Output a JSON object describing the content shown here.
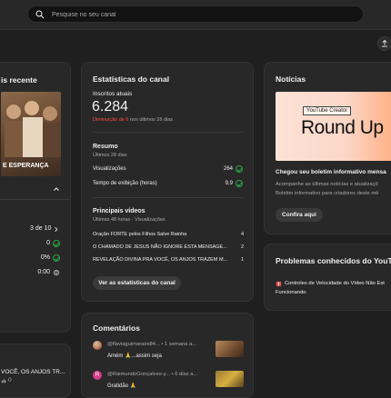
{
  "search": {
    "placeholder": "Pesquise no seu canal"
  },
  "latest_video": {
    "title_partial": "is recente",
    "thumbnail_text": "E ESPERANÇA",
    "rows": [
      {
        "value": "3 de 10"
      },
      {
        "value": "0"
      },
      {
        "value": "0%"
      },
      {
        "value": "0:00"
      }
    ],
    "bottom_title": "VOCÊ, OS ANJOS TR...",
    "bottom_value": "0"
  },
  "analytics": {
    "title": "Estatísticas do canal",
    "subs_label": "Inscritos atuais",
    "subs_value": "6.284",
    "subs_change_num": "Diminuição de 6",
    "subs_change_rest": " nos últimos 28 dias",
    "summary_title": "Resumo",
    "summary_period": "Últimos 28 dias",
    "summary_rows": [
      {
        "label": "Visualizações",
        "value": "264"
      },
      {
        "label": "Tempo de exibição (horas)",
        "value": "9,9"
      }
    ],
    "top_title": "Principais vídeos",
    "top_sub": "Últimas 48 horas · Visualizações",
    "top_videos": [
      {
        "title": "Oração FORTE pelos Filhos Salve Rainha",
        "views": "4"
      },
      {
        "title": "O CHAMADO DE JESUS NÃO IGNORE ESTA MENSAGE...",
        "views": "2"
      },
      {
        "title": "REVELAÇÃO DIVINA PRA VOCÊ, OS ANJOS TRAZEM M...",
        "views": "1"
      }
    ],
    "button": "Ver as estatísticas do canal"
  },
  "comments": {
    "title": "Comentários",
    "items": [
      {
        "author": "@flaviaguimaraes84...",
        "time": "• 1 semana a...",
        "text": "Amém 🙏...assim seja",
        "avatar_letter": ""
      },
      {
        "author": "@RaimundoGonçalves-y...",
        "time": "• 6 dias a...",
        "text": "Gratidão 🙏",
        "avatar_letter": "R"
      }
    ]
  },
  "news": {
    "title": "Notícias",
    "banner_tag": "YouTube Creator",
    "banner_text": "Round Up",
    "headline": "Chegou seu boletim informativo mensa",
    "desc1": "Acompanhe as últimas notícias e atualizaçõ",
    "desc2": "Boletim informativo para criadores deste mê",
    "button": "Confira aqui"
  },
  "known_issues": {
    "title": "Problemas conhecidos do YouTub",
    "item_line1": "Controles de Velocidade do Vídeo Não Est",
    "item_line2": "Funcionando"
  },
  "colors": {
    "accent_red": "#ff4e45",
    "check_green": "#2ba640",
    "banner_peach": "#fcd7c8"
  }
}
